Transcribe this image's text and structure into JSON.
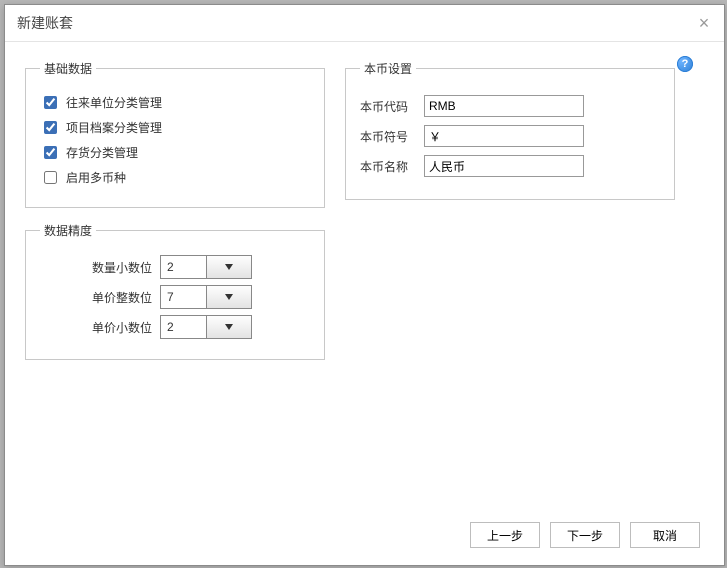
{
  "dialog": {
    "title": "新建账套",
    "close_tooltip": "关闭"
  },
  "basic_data": {
    "legend": "基础数据",
    "checkboxes": [
      {
        "label": "往来单位分类管理",
        "checked": true
      },
      {
        "label": "项目档案分类管理",
        "checked": true
      },
      {
        "label": "存货分类管理",
        "checked": true
      },
      {
        "label": "启用多币种",
        "checked": false
      }
    ]
  },
  "precision": {
    "legend": "数据精度",
    "rows": [
      {
        "label": "数量小数位",
        "value": "2"
      },
      {
        "label": "单价整数位",
        "value": "7"
      },
      {
        "label": "单价小数位",
        "value": "2"
      }
    ]
  },
  "currency": {
    "legend": "本币设置",
    "rows": [
      {
        "label": "本币代码",
        "value": "RMB"
      },
      {
        "label": "本币符号",
        "value": "￥"
      },
      {
        "label": "本币名称",
        "value": "人民币"
      }
    ]
  },
  "help": {
    "symbol": "?"
  },
  "footer": {
    "prev": "上一步",
    "next": "下一步",
    "cancel": "取消"
  }
}
